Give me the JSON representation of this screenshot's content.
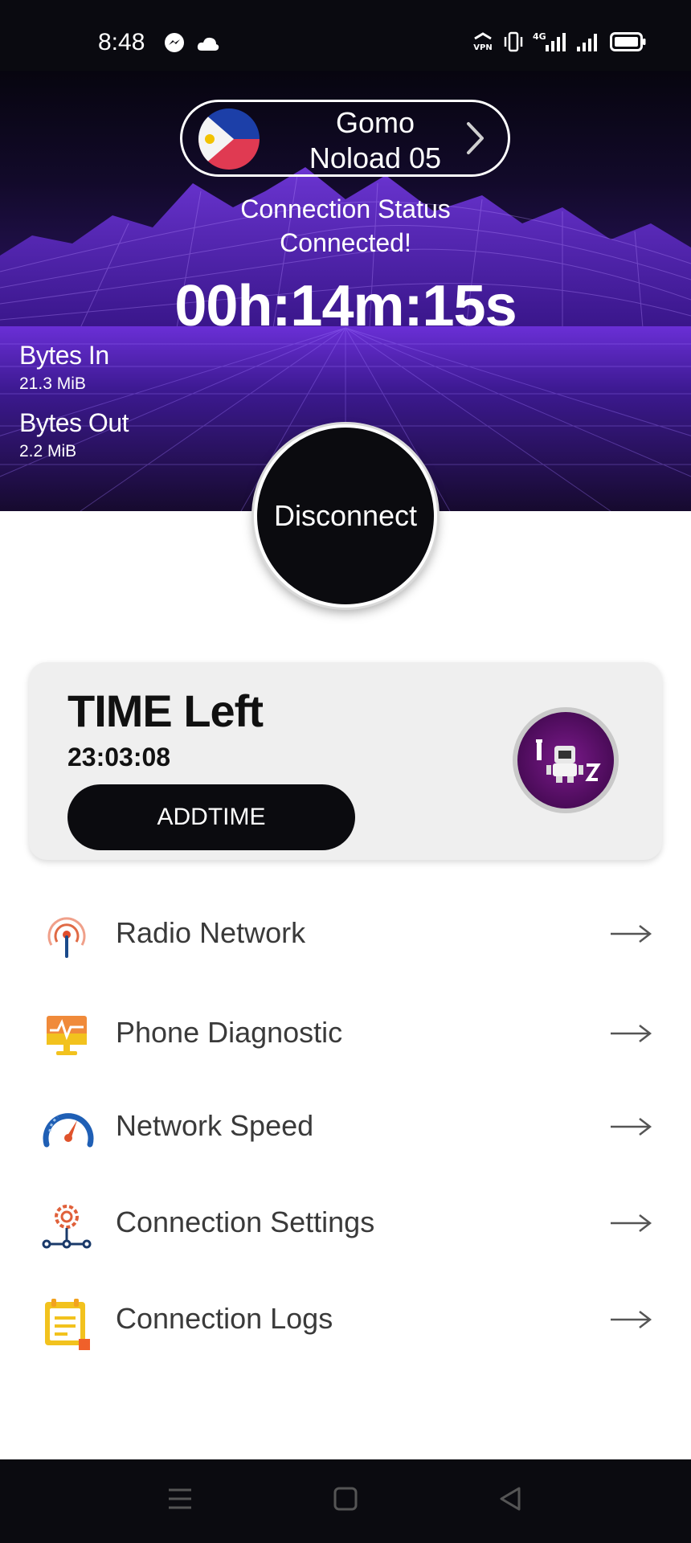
{
  "status_bar": {
    "time": "8:48",
    "icons": [
      "messenger-icon",
      "cloud-icon",
      "vpn-icon",
      "vibrate-icon",
      "4g-signal-icon",
      "signal-icon",
      "battery-icon"
    ]
  },
  "server": {
    "name_line1": "Gomo",
    "name_line2": "Noload 05",
    "flag_icon": "philippines-flag-icon"
  },
  "connection": {
    "title": "Connection Status",
    "state": "Connected!",
    "timer": "00h:14m:15s"
  },
  "bytes": {
    "in_label": "Bytes In",
    "in_value": "21.3 MiB",
    "out_label": "Bytes Out",
    "out_value": "2.2 MiB"
  },
  "disconnect_label": "Disconnect",
  "time_card": {
    "title": "TIME Left",
    "value": "23:03:08",
    "button_label": "ADDTIME"
  },
  "menu": [
    {
      "label": "Radio Network",
      "icon": "radio-tower-icon"
    },
    {
      "label": "Phone Diagnostic",
      "icon": "diagnostic-monitor-icon"
    },
    {
      "label": "Network Speed",
      "icon": "speedometer-icon"
    },
    {
      "label": "Connection Settings",
      "icon": "gear-network-icon"
    },
    {
      "label": "Connection Logs",
      "icon": "logs-notepad-icon"
    }
  ],
  "colors": {
    "hero_purple": "#3a1a82",
    "button_black": "#0b0b0f",
    "card_gray": "#efefef"
  }
}
